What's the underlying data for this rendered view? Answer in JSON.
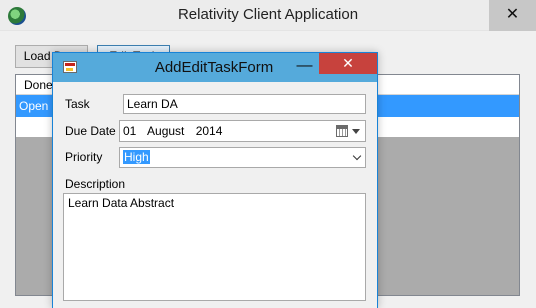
{
  "main_window": {
    "title": "Relativity Client Application",
    "close_glyph": "✕",
    "buttons": {
      "load": "Load Data",
      "edit": "Edit Task"
    },
    "grid": {
      "columns": [
        "Done"
      ],
      "rows": [
        {
          "status": "Open",
          "selected": true
        }
      ]
    }
  },
  "dialog": {
    "title": "AddEditTaskForm",
    "minimize_glyph": "—",
    "close_glyph": "✕",
    "labels": {
      "task": "Task",
      "due_date": "Due Date",
      "priority": "Priority",
      "description": "Description"
    },
    "fields": {
      "task": "Learn DA",
      "due_date": "01   August   2014",
      "priority": "High",
      "description": "Learn Data Abstract"
    }
  },
  "icons": [
    "app-icon",
    "form-icon",
    "calendar-icon",
    "chevron-down-icon"
  ],
  "colors": {
    "selection": "#3399ff",
    "dialog_titlebar": "#55aadb",
    "close_button": "#c7423d"
  }
}
